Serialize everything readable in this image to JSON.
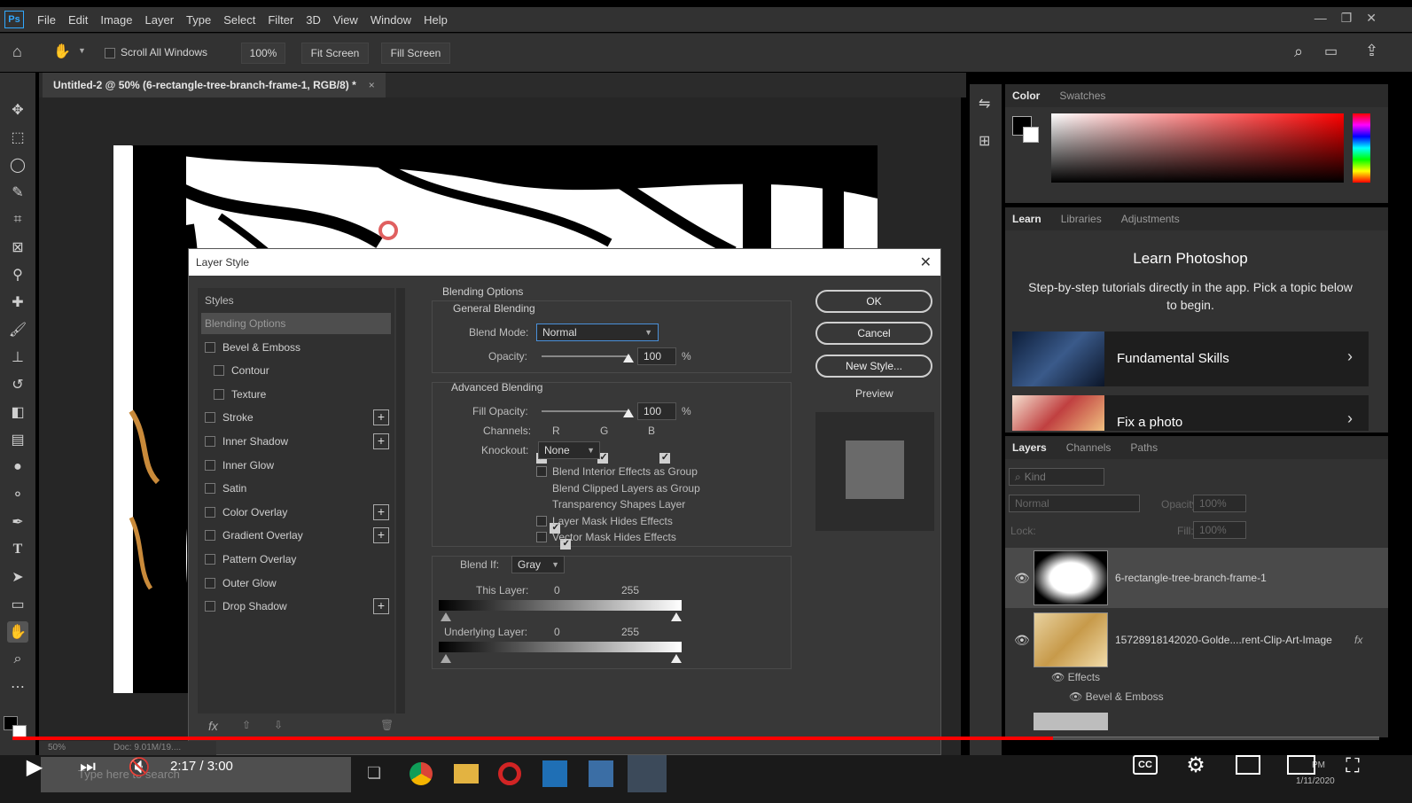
{
  "menubar": {
    "logo": "Ps",
    "items": [
      "File",
      "Edit",
      "Image",
      "Layer",
      "Type",
      "Select",
      "Filter",
      "3D",
      "View",
      "Window",
      "Help"
    ]
  },
  "options": {
    "scroll_all_windows": "Scroll All Windows",
    "zoom": "100%",
    "fit_screen": "Fit Screen",
    "fill_screen": "Fill Screen"
  },
  "document": {
    "tab_title": "Untitled-2 @ 50% (6-rectangle-tree-branch-frame-1, RGB/8) *",
    "zoom_status": "50%",
    "doc_status": "Doc: 9.01M/19...."
  },
  "color_panel": {
    "tabs": [
      "Color",
      "Swatches"
    ]
  },
  "learn_panel": {
    "tabs": [
      "Learn",
      "Libraries",
      "Adjustments"
    ],
    "heading": "Learn Photoshop",
    "subtitle": "Step-by-step tutorials directly in the app. Pick a topic below to begin.",
    "topics": [
      "Fundamental Skills",
      "Fix a photo"
    ]
  },
  "layers_panel": {
    "tabs": [
      "Layers",
      "Channels",
      "Paths"
    ],
    "filter_placeholder": "Kind",
    "blend_mode": "Normal",
    "opacity_label": "Opacity:",
    "opacity_value": "100%",
    "lock_label": "Lock:",
    "fill_label": "Fill:",
    "fill_value": "100%",
    "layers": [
      {
        "name": "6-rectangle-tree-branch-frame-1"
      },
      {
        "name": "15728918142020-Golde....rent-Clip-Art-Image",
        "fx": "fx"
      }
    ],
    "effects_label": "Effects",
    "effect_item": "Bevel & Emboss"
  },
  "dialog": {
    "title": "Layer Style",
    "styles_header": "Styles",
    "style_items": [
      {
        "label": "Blending Options",
        "checkbox": false,
        "plus": false,
        "selected": true
      },
      {
        "label": "Bevel & Emboss",
        "checkbox": true,
        "plus": false
      },
      {
        "label": "Contour",
        "checkbox": true,
        "plus": false,
        "indent": true
      },
      {
        "label": "Texture",
        "checkbox": true,
        "plus": false,
        "indent": true
      },
      {
        "label": "Stroke",
        "checkbox": true,
        "plus": true
      },
      {
        "label": "Inner Shadow",
        "checkbox": true,
        "plus": true
      },
      {
        "label": "Inner Glow",
        "checkbox": true,
        "plus": false
      },
      {
        "label": "Satin",
        "checkbox": true,
        "plus": false
      },
      {
        "label": "Color Overlay",
        "checkbox": true,
        "plus": true
      },
      {
        "label": "Gradient Overlay",
        "checkbox": true,
        "plus": true
      },
      {
        "label": "Pattern Overlay",
        "checkbox": true,
        "plus": false
      },
      {
        "label": "Outer Glow",
        "checkbox": true,
        "plus": false
      },
      {
        "label": "Drop Shadow",
        "checkbox": true,
        "plus": true
      }
    ],
    "fx_label": "fx",
    "blending_options": "Blending Options",
    "general_blending": "General Blending",
    "blend_mode_label": "Blend Mode:",
    "blend_mode_value": "Normal",
    "opacity_label": "Opacity:",
    "opacity_value": "100",
    "opacity_unit": "%",
    "opacity_level": 1.0,
    "advanced_blending": "Advanced Blending",
    "fill_opacity_label": "Fill Opacity:",
    "fill_opacity_value": "100",
    "fill_opacity_unit": "%",
    "channels_label": "Channels:",
    "channels": [
      "R",
      "G",
      "B"
    ],
    "knockout_label": "Knockout:",
    "knockout_value": "None",
    "checkboxes": [
      {
        "label": "Blend Interior Effects as Group",
        "checked": false
      },
      {
        "label": "Blend Clipped Layers as Group",
        "checked": true
      },
      {
        "label": "Transparency Shapes Layer",
        "checked": true
      },
      {
        "label": "Layer Mask Hides Effects",
        "checked": false
      },
      {
        "label": "Vector Mask Hides Effects",
        "checked": false
      }
    ],
    "blend_if_label": "Blend If:",
    "blend_if_value": "Gray",
    "this_layer_label": "This Layer:",
    "this_layer_min": "0",
    "this_layer_max": "255",
    "underlying_label": "Underlying Layer:",
    "underlying_min": "0",
    "underlying_max": "255",
    "ok": "OK",
    "cancel": "Cancel",
    "new_style": "New Style...",
    "preview": "Preview"
  },
  "player": {
    "time": "2:17 / 3:00",
    "progress": 0.7611,
    "search_placeholder": "Type here to search",
    "clock_time": "PM",
    "clock_date": "1/11/2020"
  }
}
